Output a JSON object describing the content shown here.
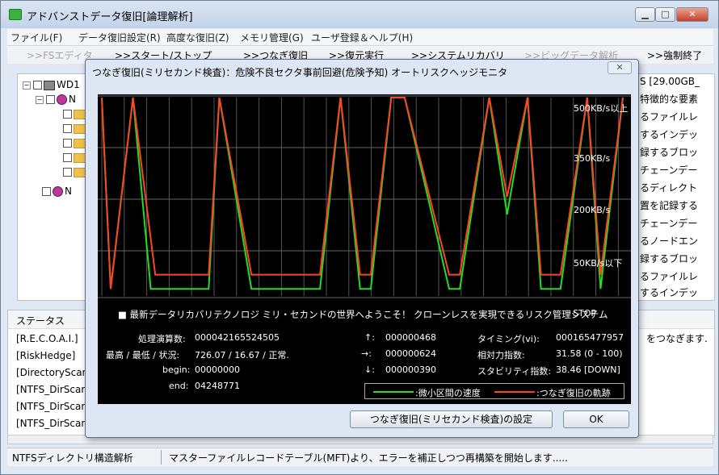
{
  "window": {
    "title": "アドバンストデータ復旧[論理解析]"
  },
  "menu": [
    "ファイル(F)",
    "データ復旧設定(R)",
    "高度な復旧(Z)",
    "メモリ管理(G)",
    "ユーザ登録＆ヘルプ(H)"
  ],
  "toolbar": {
    "fs_editor": ">>FSエディタ",
    "start_stop": ">>スタート/ストップ",
    "connect": ">>つなぎ復旧",
    "restore": ">>復元実行",
    "sys_recovery": ">>システムリカバリ",
    "bigdata": ">>ビッグデータ解析",
    "force_quit": ">>強制終了"
  },
  "tree": {
    "root_label": "WD1",
    "ntfs1": "N",
    "ntfs2": "N"
  },
  "right_list": {
    "header": "S [29.00GB_",
    "items": [
      "特徴的な要素",
      "るファイルレ",
      "するインデッ",
      "録するブロッ",
      "チェーンデー",
      "るディレクト",
      "置を記録する",
      "チェーンデー",
      "るノードエン",
      "録するブロッ",
      "るファイルレ",
      "するインデッ"
    ]
  },
  "status": {
    "header": "ステータス",
    "rows": [
      "[R.E.C.O.A.I.]",
      "[RiskHedge]",
      "[DirectoryScan",
      "[NTFS_DirScan",
      "[NTFS_DirScan",
      "[NTFS_DirScan"
    ],
    "right_text": "をつなぎます."
  },
  "statusbar": {
    "left": "NTFSディレクトリ構造解析",
    "right": "マスターファイルレコードテーブル(MFT)より、エラーを補正しつつ再構築を開始します....."
  },
  "dialog": {
    "title": "つなぎ復旧(ミリセカンド検査)：危険不良セクタ事前回避(危険予知) オートリスクヘッジモニタ",
    "close": "✕",
    "message": "最新データリカバリテクノロジ ミリ・セカンドの世界へようこそ！ クローンレスを実現できるリスク管理システム",
    "stop_label": "STOP",
    "stats": {
      "proc_label": "処理演算数:",
      "proc_value": "000042165524505",
      "minmax_label": "最高 / 最低 / 状況:",
      "minmax_value": "726.07 / 16.67 / 正常.",
      "begin_label": "begin:",
      "begin_value": "00000000",
      "end_label": "end:",
      "end_value": "04248771",
      "up_label": "↑:",
      "up_value": "000000468",
      "right_label": "→:",
      "right_value": "000000624",
      "down_label": "↓:",
      "down_value": "000000390",
      "timing_label": "タイミング(vi):",
      "timing_value": "000165477957",
      "relative_label": "相対力指数:",
      "relative_value": "31.58 (0 - 100)",
      "stability_label": "スタビリティ指数:",
      "stability_value": "38.46 [DOWN]"
    },
    "settings_button": "つなぎ復旧(ミリセカンド検査)の設定",
    "ok_button": "OK"
  },
  "chart_data": {
    "type": "line",
    "y_tick_labels": [
      "500KB/s以上",
      "350KB/s",
      "200KB/s",
      "50KB/s以下"
    ],
    "ylim": [
      0,
      560
    ],
    "grid": true,
    "legend": "bottom-right",
    "colors": {
      "speed": "#22dd22",
      "trajectory": "#ff4422"
    },
    "series": [
      {
        "name": ":微小区間の速度",
        "x": [
          0,
          10,
          35,
          55,
          120,
          132,
          168,
          180,
          245,
          268,
          290,
          302,
          325,
          340,
          390,
          402,
          435,
          455,
          478,
          493,
          515,
          545,
          560,
          585
        ],
        "values": [
          560,
          20,
          560,
          20,
          20,
          560,
          20,
          20,
          20,
          560,
          20,
          20,
          560,
          560,
          20,
          20,
          560,
          230,
          560,
          20,
          20,
          560,
          20,
          560
        ]
      },
      {
        "name": ":つなぎ復旧の軌跡",
        "x": [
          0,
          10,
          35,
          60,
          120,
          132,
          168,
          180,
          245,
          268,
          290,
          302,
          325,
          340,
          390,
          402,
          435,
          455,
          478,
          493,
          515,
          545,
          560,
          585
        ],
        "values": [
          560,
          20,
          560,
          60,
          60,
          560,
          60,
          60,
          60,
          560,
          60,
          60,
          560,
          560,
          60,
          60,
          560,
          280,
          560,
          60,
          60,
          560,
          60,
          560
        ]
      }
    ]
  }
}
